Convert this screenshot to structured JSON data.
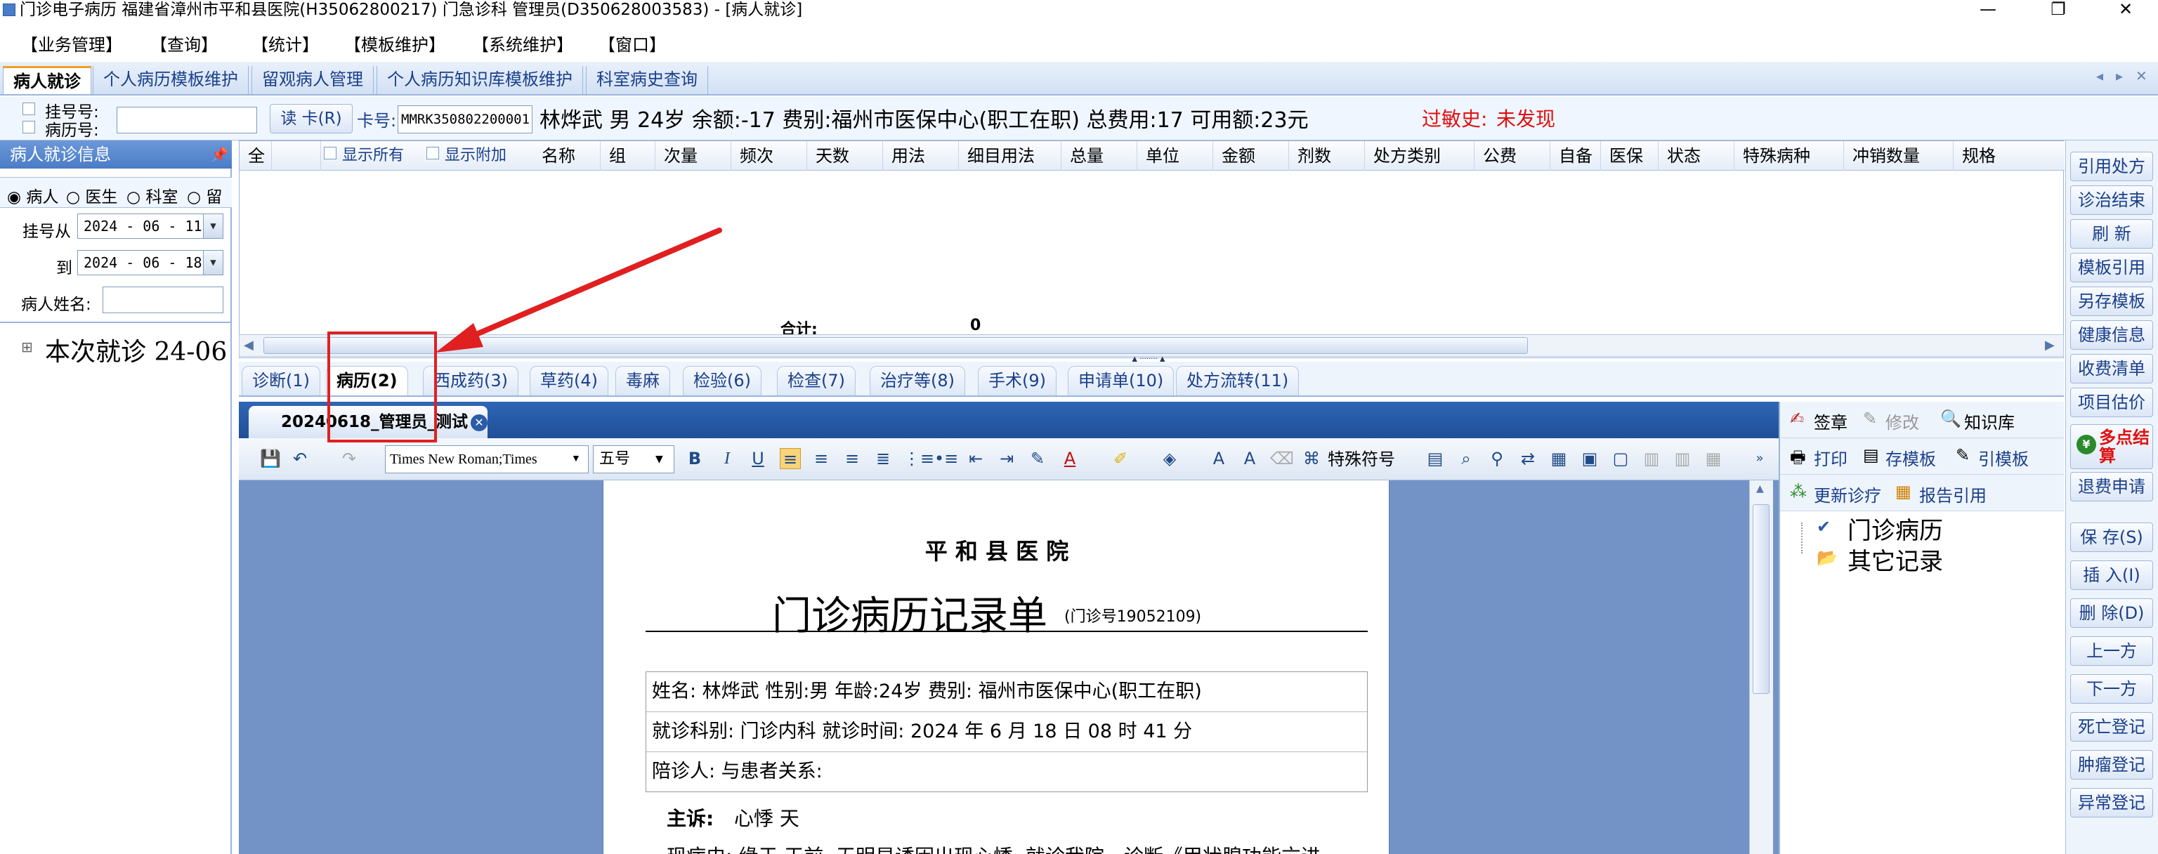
{
  "window": {
    "title": "门诊电子病历  福建省漳州市平和县医院(H35062800217)  门急诊科  管理员(D350628003583) - [病人就诊]",
    "minimize": "—",
    "restore": "❐",
    "close": "✕"
  },
  "menu": [
    "【业务管理】",
    "【查询】",
    "【统计】",
    "【模板维护】",
    "【系统维护】",
    "【窗口】"
  ],
  "top_tabs": [
    {
      "label": "病人就诊",
      "active": true
    },
    {
      "label": "个人病历模板维护",
      "active": false
    },
    {
      "label": "留观病人管理",
      "active": false
    },
    {
      "label": "个人病历知识库模板维护",
      "active": false
    },
    {
      "label": "科室病史查询",
      "active": false
    }
  ],
  "tab_nav": {
    "prev": "◂",
    "next": "▸",
    "close": "✕"
  },
  "infobar": {
    "reg_no_label": "挂号号:",
    "record_no_label": "病历号:",
    "read_card_button": "读 卡(R)",
    "card_no_label": "卡号:",
    "card_no_value": "MMRK350802200001",
    "patient_summary": "林烨武  男  24岁  余额:-17  费别:福州市医保中心(职工在职)  总费用:17  可用额:23元",
    "allergy_label": "过敏史:",
    "allergy_value": "未发现",
    "allergy_color": "#e01010"
  },
  "left_panel": {
    "title": "病人就诊信息",
    "pin_icon": "pin-icon",
    "radios": [
      {
        "label": "病人",
        "selected": true
      },
      {
        "label": "医生",
        "selected": false
      },
      {
        "label": "科室",
        "selected": false
      },
      {
        "label": "留",
        "selected": false
      }
    ],
    "reg_from_label": "挂号从",
    "reg_from_value": "2024 - 06 - 11",
    "to_label": "到",
    "to_value": "2024 - 06 - 18",
    "name_label": "病人姓名:",
    "tree_expand": "⊞",
    "tree_item": "本次就诊  24-06"
  },
  "grid": {
    "show_all": "显示所有",
    "show_extra": "显示附加",
    "columns": [
      "全",
      "名称",
      "组",
      "次量",
      "频次",
      "天数",
      "用法",
      "细目用法",
      "总量",
      "单位",
      "金额",
      "剂数",
      "处方类别",
      "公费",
      "自备",
      "医保",
      "状态",
      "特殊病种",
      "冲销数量",
      "规格"
    ],
    "total_label": "合计:",
    "total_value": "0"
  },
  "sub_tabs": [
    {
      "label": "诊断(1)",
      "active": false
    },
    {
      "label": "病历(2)",
      "active": true
    },
    {
      "label": "西成药(3)",
      "active": false
    },
    {
      "label": "草药(4)",
      "active": false
    },
    {
      "label": "毒麻",
      "active": false
    },
    {
      "label": "检验(6)",
      "active": false
    },
    {
      "label": "检查(7)",
      "active": false
    },
    {
      "label": "治疗等(8)",
      "active": false
    },
    {
      "label": "手术(9)",
      "active": false
    },
    {
      "label": "申请单(10)",
      "active": false
    },
    {
      "label": "处方流转(11)",
      "active": false
    }
  ],
  "doc_tab": {
    "label": "20240618_管理员_测试"
  },
  "editor_toolbar": {
    "font_name": "Times New Roman;Times",
    "font_size": "五号",
    "special_chars": "特殊符号"
  },
  "document": {
    "hospital": "平 和 县 医 院",
    "title": "门诊病历记录单",
    "clinic_no": "(门诊号19052109)",
    "row1": "姓名: 林烨武     性别:男     年龄:24岁     费别: 福州市医保中心(职工在职)",
    "row2": "就诊科别: 门诊内科   就诊时间: 2024 年 6 月 18 日 08 时 41 分",
    "row3": "陪诊人:           与患者关系:",
    "complaint_label": "主诉:",
    "complaint_value": "心悸     天",
    "history_partial": "现病史: 缘于    天前, 无明显诱因出现心悸, 就诊我院。诊断《甲状腺功能亢进"
  },
  "right_panel": {
    "row1": [
      "签章",
      "修改",
      "知识库"
    ],
    "row2": [
      "打印",
      "存模板",
      "引模板"
    ],
    "row3": [
      "更新诊疗",
      "报告引用"
    ],
    "tree": [
      "门诊病历",
      "其它记录"
    ]
  },
  "right_buttons": [
    "引用处方",
    "诊治结束",
    "刷 新",
    "模板引用",
    "另存模板",
    "健康信息",
    "收费清单",
    "项目估价",
    "多点结算",
    "退费申请",
    "保 存(S)",
    "插 入(I)",
    "删 除(D)",
    "上一方",
    "下一方",
    "死亡登记",
    "肿瘤登记",
    "异常登记"
  ],
  "colors": {
    "accent": "#4a7cc7",
    "highlight_box": "#e02020",
    "arrow": "#e02020"
  }
}
